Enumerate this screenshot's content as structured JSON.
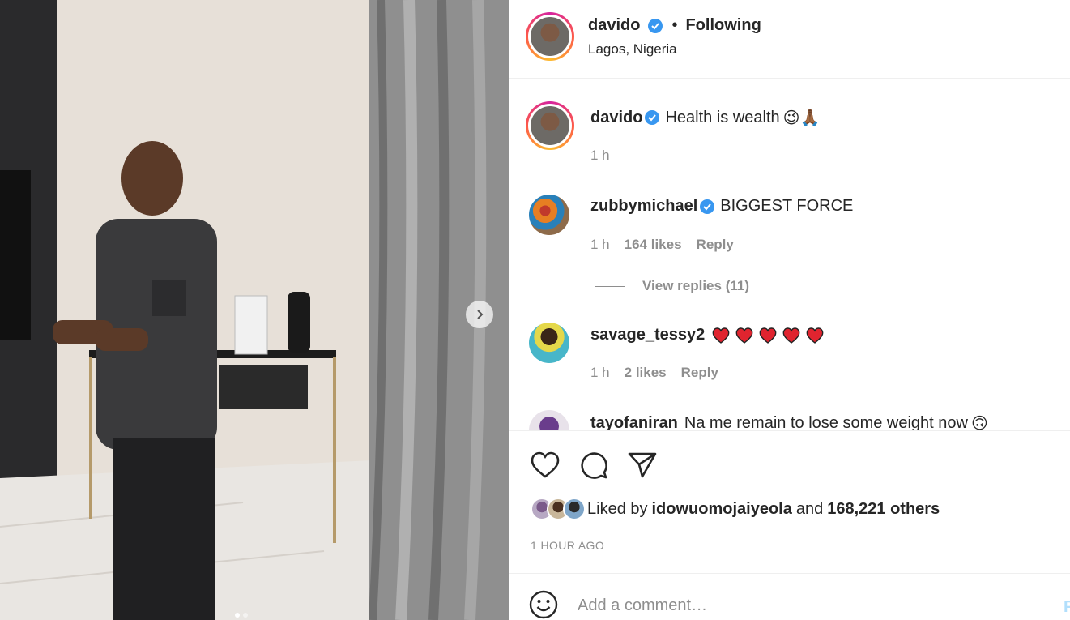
{
  "post": {
    "author": "davido",
    "follow_separator": "•",
    "follow_label": "Following",
    "location": "Lagos, Nigeria",
    "caption": {
      "username": "davido",
      "text": "Health is wealth",
      "emojis": "😉🙏🏾",
      "time": "1 h"
    }
  },
  "comments": [
    {
      "username": "zubbymichael",
      "verified": true,
      "text": "BIGGEST FORCE",
      "time": "1 h",
      "likes": "164 likes",
      "reply_label": "Reply"
    },
    {
      "username": "savage_tessy2",
      "verified": false,
      "text": "",
      "emojis": "❤️❤️❤️❤️❤️",
      "time": "1 h",
      "likes": "2 likes",
      "reply_label": "Reply"
    },
    {
      "username": "tayofaniran",
      "verified": false,
      "text": "Na me remain to lose some weight now",
      "emojis": "🙃"
    }
  ],
  "view_replies_label": "View replies (11)",
  "likes": {
    "prefix": "Liked by",
    "first_liker": "idowuomojaiyeola",
    "joiner": "and",
    "others": "168,221 others"
  },
  "timestamp": "1 HOUR AGO",
  "add_comment": {
    "placeholder": "Add a comment…",
    "post_label": "Post"
  },
  "colors": {
    "verified": "#3897f0",
    "muted": "#8e8e8e",
    "heart": "#ed4956"
  },
  "icons": [
    "heart-icon",
    "comment-icon",
    "share-icon",
    "emoji-icon",
    "chevron-right-icon",
    "verified-badge-icon"
  ]
}
